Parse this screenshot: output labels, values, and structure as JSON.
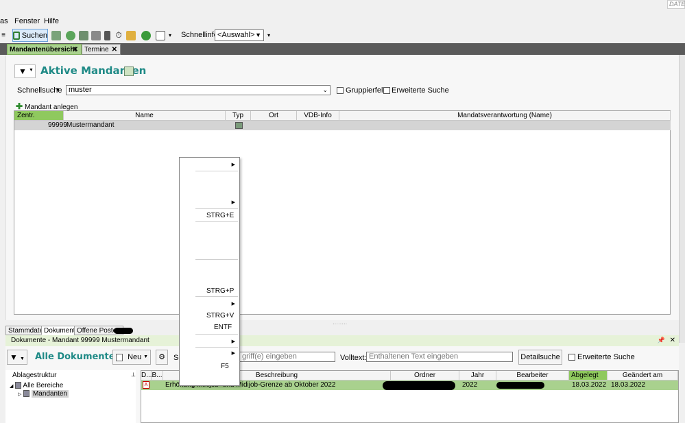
{
  "menubar": {
    "items": [
      "as",
      "Fenster",
      "Hilfe"
    ],
    "date_label": "DATE"
  },
  "toolbar": {
    "search_label": "Suchen",
    "quickinfo_label": "Schnellinfo:",
    "quickinfo_value": "<Auswahl>"
  },
  "tabs": [
    {
      "label": "Mandantenübersicht",
      "active": true
    },
    {
      "label": "Termine",
      "active": false
    }
  ],
  "mandanten": {
    "title": "Aktive Mandanten",
    "quicksearch_label": "Schnellsuche",
    "quicksearch_value": "muster",
    "group_field_label": "Gruppierfeld",
    "extended_search_label": "Erweiterte Suche",
    "add_label": "Mandant anlegen",
    "columns": [
      "Zentr. Mandant",
      "Name",
      "Typ",
      "Ort",
      "VDB-Info",
      "Mandatsverantwortung (Name)"
    ],
    "row": {
      "number": "99999",
      "name": "Mustermandant"
    }
  },
  "context_menu": {
    "shortcuts": [
      "STRG+E",
      "STRG+P",
      "STRG+V",
      "ENTF",
      "F5"
    ]
  },
  "bottom_tabs": [
    "Stammdaten",
    "Dokumente",
    "Offene Posten"
  ],
  "documents": {
    "header": "Dokumente - Mandant 99999 Mustermandant",
    "title": "Alle Dokumente",
    "new_label": "Neu",
    "search_prefix": "Sc",
    "search_placeholder": "griff(e) eingeben",
    "fulltext_label": "Volltext:",
    "fulltext_placeholder": "Enthaltenen Text eingeben",
    "detail_search_label": "Detailsuche",
    "extended_search_label": "Erweiterte Suche",
    "tree_header": "Ablagestruktur",
    "tree_items": [
      "Alle Bereiche",
      "Mandanten"
    ],
    "columns": [
      "D...",
      "B...",
      "Beschreibung",
      "Ordner",
      "Jahr",
      "Bearbeiter",
      "Abgelegt am",
      "Geändert am"
    ],
    "row": {
      "description": "Erhöhung Minijob- und Midijob-Grenze ab Oktober 2022",
      "year": "2022",
      "filed": "18.03.2022",
      "changed": "18.03.2022"
    }
  },
  "colors": {
    "accent_green": "#a9d18e",
    "sorted_header": "#8fc95e",
    "title_teal": "#1f8a86",
    "tabbar_dark": "#5a5a5a"
  }
}
